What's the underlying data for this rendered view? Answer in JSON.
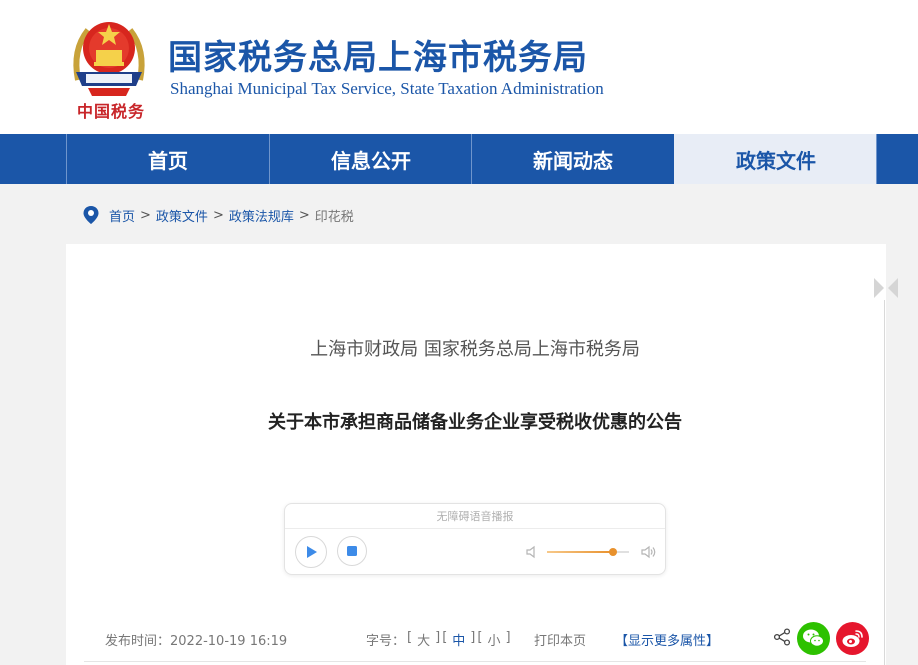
{
  "site": {
    "title_cn": "国家税务总局上海市税务局",
    "title_en": "Shanghai Municipal Tax Service, State Taxation Administration",
    "emblem_caption": "中国税务"
  },
  "nav": {
    "items": [
      {
        "label": "首页"
      },
      {
        "label": "信息公开"
      },
      {
        "label": "新闻动态"
      },
      {
        "label": "政策文件",
        "active": true
      }
    ]
  },
  "breadcrumb": {
    "items": [
      "首页",
      "政策文件",
      "政策法规库"
    ],
    "separator": ">",
    "current": "印花税"
  },
  "article": {
    "issuer": "上海市财政局 国家税务总局上海市税务局",
    "title": "关于本市承担商品储备业务企业享受税收优惠的公告"
  },
  "player": {
    "label": "无障碍语音播报",
    "volume": 0.8
  },
  "meta": {
    "publish_label": "发布时间：",
    "publish_date": "2022-10-19 16:19",
    "font_size_label": "字号：",
    "font_sizes": [
      "大",
      "中",
      "小"
    ],
    "font_size_active": "中",
    "print_label": "打印本页",
    "more_label": "【显示更多属性】"
  },
  "colors": {
    "brand_blue": "#1b56a8",
    "nav_active_bg": "#e8edf6",
    "wechat_green": "#2dc100",
    "weibo_red": "#e6162d",
    "volume_orange": "#e8912d"
  }
}
